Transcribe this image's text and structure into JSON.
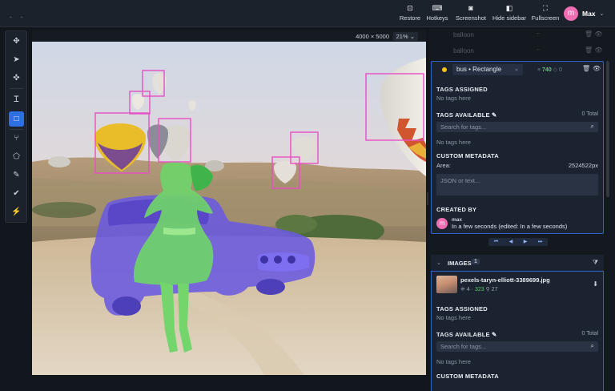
{
  "topbar": {
    "left_mark": "-  -",
    "buttons": [
      {
        "icon": "restore-icon",
        "glyph": "⊡",
        "label": "Restore"
      },
      {
        "icon": "keyboard-icon",
        "glyph": "⌨",
        "label": "Hotkeys"
      },
      {
        "icon": "camera-icon",
        "glyph": "◙",
        "label": "Screenshot"
      },
      {
        "icon": "sidebar-icon",
        "glyph": "◧",
        "label": "Hide sidebar"
      },
      {
        "icon": "fullscreen-icon",
        "glyph": "⛶",
        "label": "Fullscreen"
      }
    ],
    "user": {
      "initial": "m",
      "name": "Max",
      "avatar_color": "#f06db3"
    }
  },
  "tools": [
    {
      "name": "move",
      "glyph": "✥"
    },
    {
      "name": "select",
      "glyph": "➤"
    },
    {
      "name": "pan",
      "glyph": "✜"
    },
    {
      "name": "text",
      "glyph": "Ꮖ"
    },
    {
      "name": "rectangle",
      "glyph": "□",
      "active": true
    },
    {
      "name": "polygon-points",
      "glyph": "⑂"
    },
    {
      "name": "polygon",
      "glyph": "⬠"
    },
    {
      "name": "brush",
      "glyph": "✎"
    },
    {
      "name": "check",
      "glyph": "✔"
    },
    {
      "name": "magic-wand",
      "glyph": "⚡"
    }
  ],
  "canvas": {
    "dims": "4000 × 5000",
    "zoom": "21%"
  },
  "annotations_faded": [
    {
      "name": "balloon",
      "count": "--"
    },
    {
      "name": "balloon",
      "count": "--"
    }
  ],
  "active_annotation": {
    "label": "bus • Rectangle",
    "count": "740",
    "extra": "0",
    "tags_assigned_title": "TAGS ASSIGNED",
    "tags_assigned_empty": "No tags here",
    "tags_available_title": "TAGS AVAILABLE",
    "tags_available_total": "0 Total",
    "search_placeholder": "Search for tags...",
    "tags_available_empty": "No tags here",
    "metadata_title": "CUSTOM METADATA",
    "area_label": "Area:",
    "area_value": "2524522px",
    "json_placeholder": "JSON or text...",
    "created_title": "CREATED BY",
    "creator_initial": "m",
    "creator": "max",
    "created_when": "In a few seconds (edited: In a few seconds)"
  },
  "images_section": {
    "title": "IMAGES",
    "count": "1"
  },
  "image_item": {
    "filename": "pexels-taryn-elliott-3389699.jpg",
    "stat_a": "4",
    "stat_b": "323",
    "stat_c": "27",
    "tags_assigned_title": "TAGS ASSIGNED",
    "tags_assigned_empty": "No tags here",
    "tags_available_title": "TAGS AVAILABLE",
    "tags_available_total": "0 Total",
    "search_placeholder": "Search for tags...",
    "tags_available_empty": "No tags here",
    "metadata_title": "CUSTOM METADATA"
  },
  "colors": {
    "accent": "#2f6fe4",
    "mask_person": "#6fd46a",
    "mask_car": "#6a5ae0",
    "box": "#e84fc4"
  }
}
